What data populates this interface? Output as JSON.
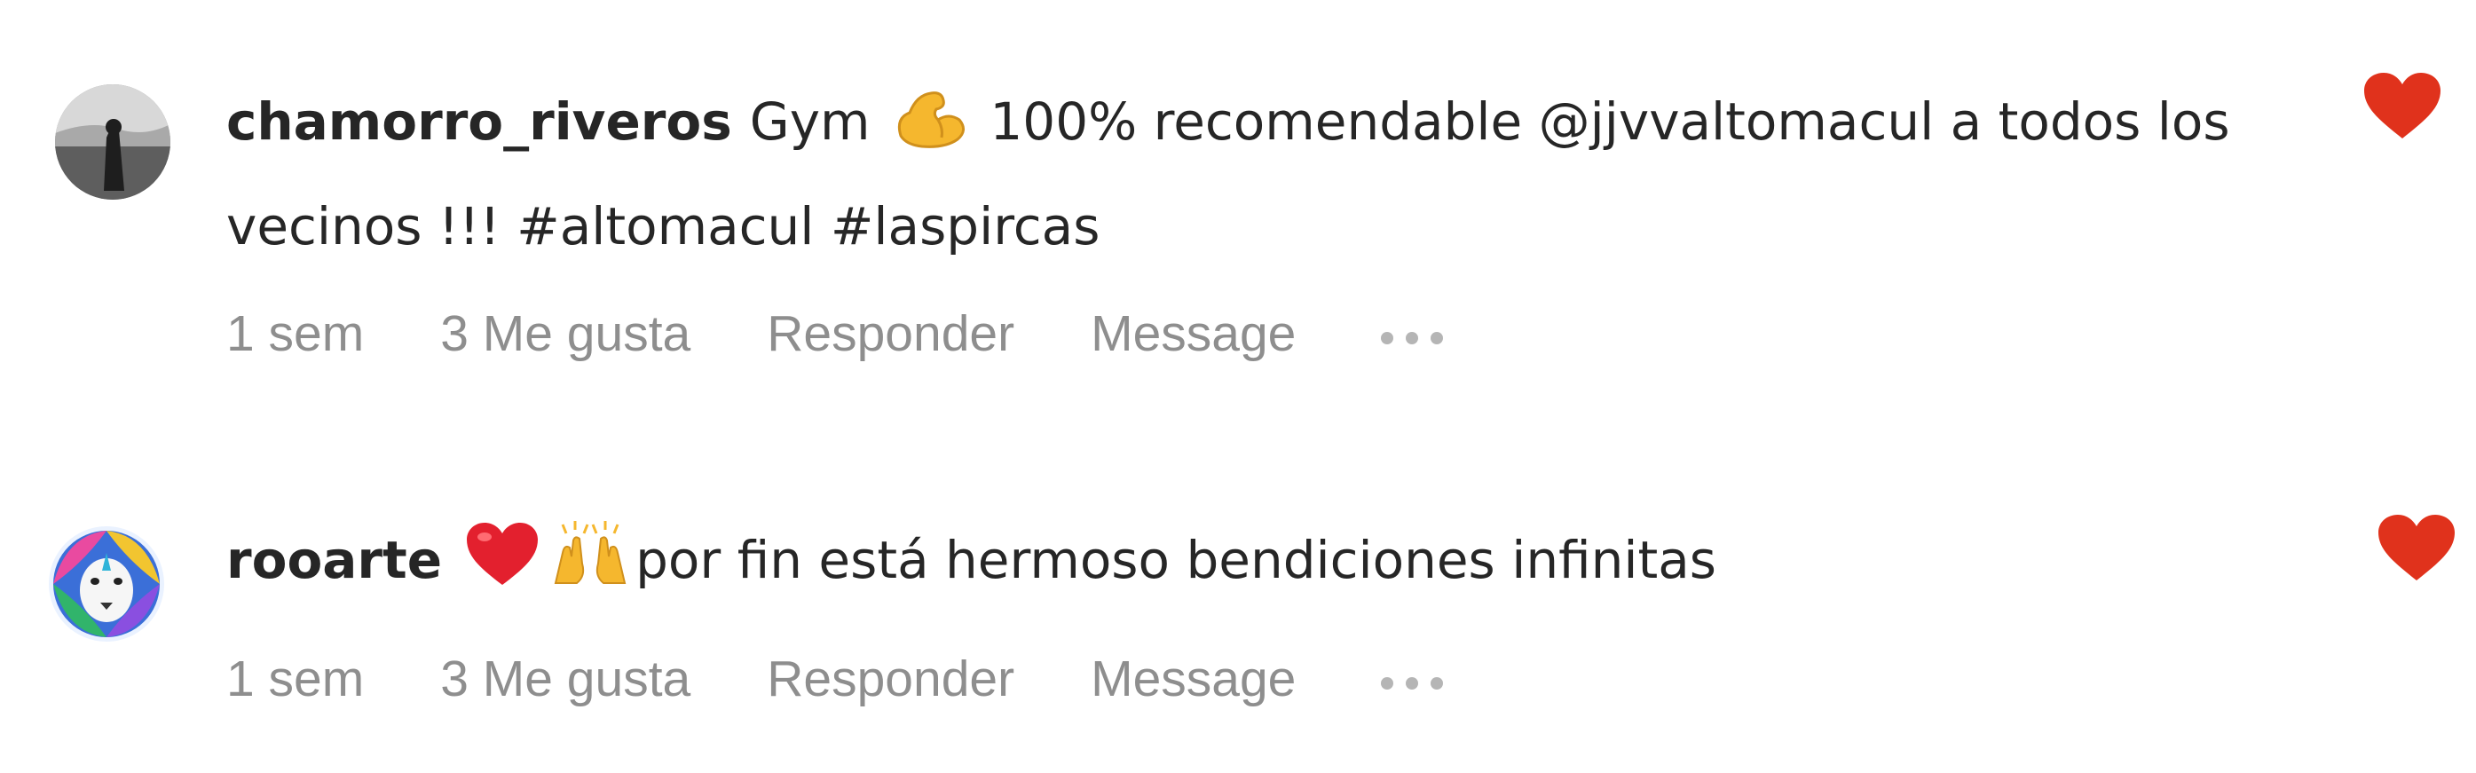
{
  "comments": [
    {
      "avatar_icon": "user-avatar-photo",
      "username": "chamorro_riveros",
      "text_before_emoji": "Gym",
      "emoji_1": "flexed-biceps-emoji",
      "text_after_emoji": "100% recomendable @jjvvaltomacul a todos los vecinos !!! #altomacul #laspircas",
      "time": "1 sem",
      "likes": "3 Me gusta",
      "reply_label": "Responder",
      "message_label": "Message",
      "more_icon": "more-options-icon",
      "liked": true,
      "like_icon": "heart-icon",
      "like_color": "#e0321c"
    },
    {
      "avatar_icon": "lion-avatar",
      "username": "rooarte",
      "emoji_1": "red-heart-emoji",
      "emoji_2": "raising-hands-emoji",
      "text_after_emoji": "por fin está hermoso bendiciones infinitas",
      "time": "1 sem",
      "likes": "3 Me gusta",
      "reply_label": "Responder",
      "message_label": "Message",
      "more_icon": "more-options-icon",
      "liked": true,
      "like_icon": "heart-icon",
      "like_color": "#e0321c"
    }
  ]
}
